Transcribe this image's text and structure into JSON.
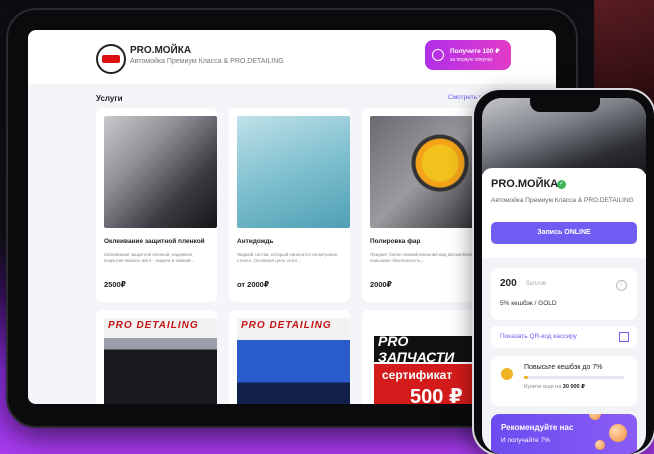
{
  "tablet": {
    "brand": "PRO.МОЙКА",
    "tagline": "Автомойка Премиум Класса & PRO.DETAILING",
    "cta": {
      "line1": "Получите 100 ₽",
      "line2": "за первую покупку"
    },
    "section_title": "Услуги",
    "see_all": "Смотреть все",
    "services": [
      {
        "name": "Оклеивание защитной пленкой",
        "desc": "Оклеивание защитной пленкой, надежное покрытие Вашего авто - защита в зимний...",
        "price": "2500₽"
      },
      {
        "name": "Антидождь",
        "desc": "Жидкий состав, который наносится на ветровое стекло. Основная цель этого...",
        "price": "от 2000₽"
      },
      {
        "name": "Полировка фар",
        "desc": "Придает более свежий внешний вид автомобилю и повышает безопасность...",
        "price": "2000₽"
      }
    ],
    "promo_cards": [
      {
        "brand_text": "PRO DETAILING"
      },
      {
        "brand_text": "PRO DETAILING"
      },
      {
        "badge": "PRO ЗАПЧАСТИ",
        "cert": "сертификат",
        "amount": "500 ₽"
      }
    ]
  },
  "phone": {
    "brand": "PRO.МОЙКА",
    "verified": "✓",
    "tagline": "Автомойка Премиум Класса & PRO.DETAILING",
    "signup": "Запись ONLINE",
    "points": {
      "value": "200",
      "unit": "баллов",
      "level": "5% кешбэк / GOLD",
      "info": "i"
    },
    "qr_label": "Показать QR-код кассиру",
    "boost": {
      "title": "Повысьте кешбэк до 7%",
      "progress": 0.04,
      "note_prefix": "Купите еще на",
      "note_amount": "30 000 ₽"
    },
    "refer": {
      "title": "Рекомендуйте нас",
      "sub": "И получайте 7%"
    }
  }
}
